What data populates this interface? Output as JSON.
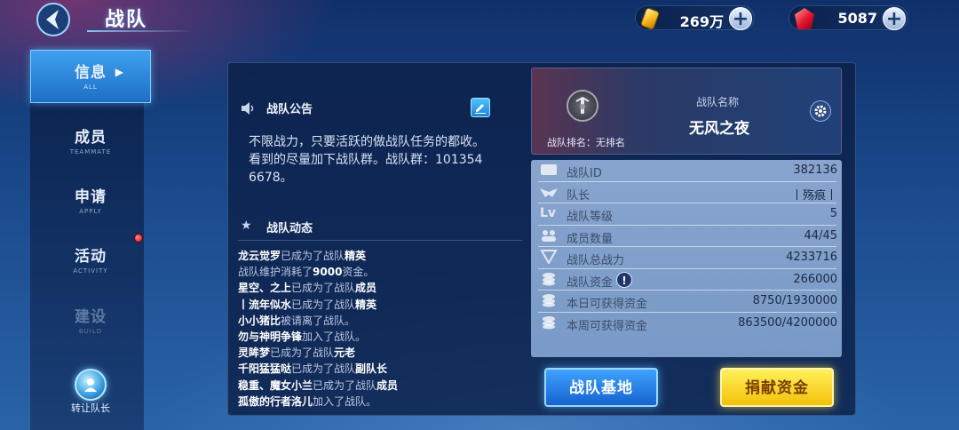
{
  "header": {
    "title": "战队"
  },
  "currencies": {
    "gold": "269万",
    "gems": "5087",
    "plus": "+"
  },
  "sidebar": {
    "tabs": [
      {
        "label": "信息",
        "sub": "ALL"
      },
      {
        "label": "成员",
        "sub": "TEAMMATE"
      },
      {
        "label": "申请",
        "sub": "APPLY"
      },
      {
        "label": "活动",
        "sub": "ACTIVITY"
      },
      {
        "label": "建设",
        "sub": "BUILD"
      }
    ],
    "transfer_label": "转让队长"
  },
  "notice": {
    "title": "战队公告",
    "lines": [
      "不限战力，只要活跃的做战队任务的都收。",
      "看到的尽量加下战队群。战队群：101354",
      "6678。"
    ]
  },
  "news": {
    "title": "战队动态",
    "items": [
      {
        "name": "龙云觉罗",
        "text": "已成为了战队",
        "tail": "精英"
      },
      {
        "name": "",
        "text": "战队维护消耗了",
        "tail": "9000",
        "after": "资金。"
      },
      {
        "name": "星空、之上",
        "text": "已成为了战队",
        "tail": "成员"
      },
      {
        "name": "丨流年似水",
        "text": "已成为了战队",
        "tail": "精英"
      },
      {
        "name": "小小猪比",
        "text": "被请离了战队。",
        "tail": ""
      },
      {
        "name": "勿与神明争锋",
        "text": "加入了战队。",
        "tail": ""
      },
      {
        "name": "灵眸梦",
        "text": "已成为了战队",
        "tail": "元老"
      },
      {
        "name": "千阳猛猛哒",
        "text": "已成为了战队",
        "tail": "副队长"
      },
      {
        "name": "稳重、魔女小兰",
        "text": "已成为了战队",
        "tail": "成员"
      },
      {
        "name": "孤傲的行者洛儿",
        "text": "加入了战队。",
        "tail": ""
      }
    ]
  },
  "team": {
    "rank_label": "战队排名：无排名",
    "name_label": "战队名称",
    "name": "无风之夜"
  },
  "stats": [
    {
      "key": "战队ID",
      "value": "382136"
    },
    {
      "key": "队长",
      "value": "丨殇痕丨"
    },
    {
      "key": "战队等级",
      "value": "5"
    },
    {
      "key": "成员数量",
      "value": "44/45"
    },
    {
      "key": "战队总战力",
      "value": "4233716"
    },
    {
      "key": "战队资金",
      "value": "266000"
    },
    {
      "key": "本日可获得资金",
      "value": "8750/1930000"
    },
    {
      "key": "本周可获得资金",
      "value": "863500/4200000"
    }
  ],
  "buttons": {
    "base": "战队基地",
    "donate": "捐献资金"
  },
  "colors": {
    "accent_blue": "#1d6fc6",
    "gold_button": "#f3c10a",
    "panel": "#0c2048"
  }
}
